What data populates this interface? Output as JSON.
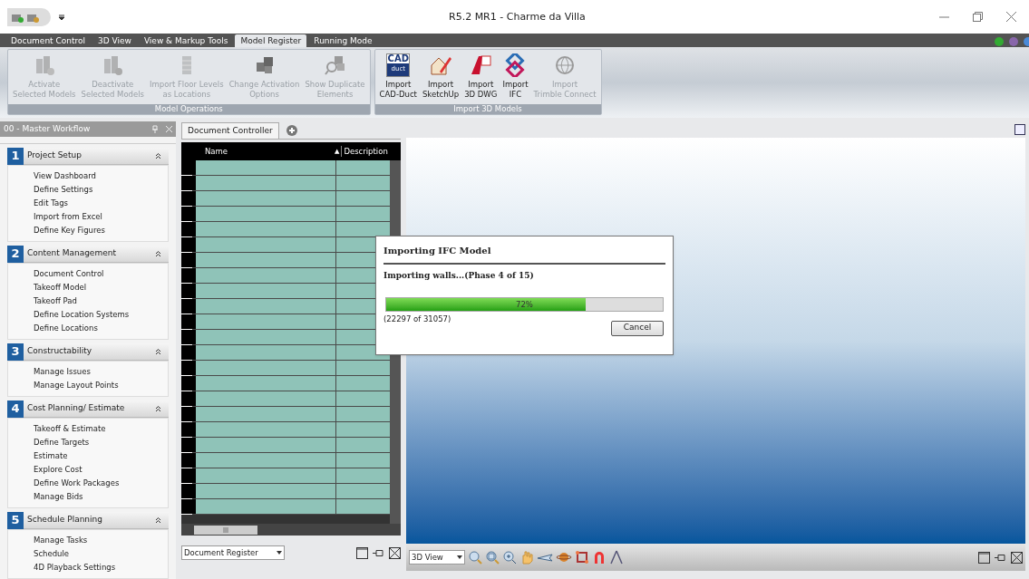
{
  "window": {
    "title": "R5.2 MR1 - Charme da Villa"
  },
  "ribbon_tabs": [
    {
      "label": "Document Control",
      "selected": false
    },
    {
      "label": "3D View",
      "selected": false
    },
    {
      "label": "View & Markup Tools",
      "selected": false
    },
    {
      "label": "Model Register",
      "selected": true
    },
    {
      "label": "Running Mode",
      "selected": false
    }
  ],
  "ribbon_groups": [
    {
      "label": "Model Operations",
      "buttons": [
        {
          "kind": "activate",
          "label": [
            "Activate",
            "Selected Models"
          ],
          "disabled": true
        },
        {
          "kind": "deactivate",
          "label": [
            "Deactivate",
            "Selected Models"
          ],
          "disabled": true
        },
        {
          "kind": "floors",
          "label": [
            "Import Floor Levels",
            "as Locations"
          ],
          "disabled": true
        },
        {
          "kind": "cubes",
          "label": [
            "Change Activation",
            "Options"
          ],
          "disabled": true
        },
        {
          "kind": "duplicate",
          "label": [
            "Show Duplicate",
            "Elements"
          ],
          "disabled": true
        }
      ]
    },
    {
      "label": "Import 3D Models",
      "buttons": [
        {
          "kind": "cad",
          "label": [
            "Import",
            "CAD-Duct"
          ],
          "disabled": false,
          "icon_text": [
            "CAD",
            "duct"
          ]
        },
        {
          "kind": "sketchup",
          "label": [
            "Import",
            "SketchUp"
          ],
          "disabled": false
        },
        {
          "kind": "dwg",
          "label": [
            "Import",
            "3D DWG"
          ],
          "disabled": false
        },
        {
          "kind": "ifc",
          "label": [
            "Import",
            "IFC"
          ],
          "disabled": false
        },
        {
          "kind": "trimble",
          "label": [
            "Import",
            "Trimble Connect"
          ],
          "disabled": true
        }
      ]
    }
  ],
  "workflow": {
    "title": "00 - Master Workflow",
    "sections": [
      {
        "number": "1",
        "title": "Project Setup",
        "expanded": true,
        "items": [
          "View Dashboard",
          "Define Settings",
          "Edit Tags",
          "Import from Excel",
          "Define Key Figures"
        ]
      },
      {
        "number": "2",
        "title": "Content Management",
        "expanded": true,
        "items": [
          "Document Control",
          "Takeoff Model",
          "Takeoff Pad",
          "Define Location Systems",
          "Define Locations"
        ]
      },
      {
        "number": "3",
        "title": "Constructability",
        "expanded": true,
        "items": [
          "Manage Issues",
          "Manage Layout Points"
        ]
      },
      {
        "number": "4",
        "title": "Cost Planning/ Estimate",
        "expanded": true,
        "items": [
          "Takeoff & Estimate",
          "Define Targets",
          "Estimate",
          "Explore Cost",
          "Define Work Packages",
          "Manage Bids"
        ]
      },
      {
        "number": "5",
        "title": "Schedule Planning",
        "expanded": true,
        "items": [
          "Manage Tasks",
          "Schedule",
          "4D Playback Settings"
        ]
      }
    ]
  },
  "document_tabs": [
    {
      "label": "Document Controller",
      "selected": true
    }
  ],
  "grid": {
    "columns": [
      "Name",
      "Description"
    ],
    "sort_mark": "▲"
  },
  "register_dropdown": {
    "value": "Document Register"
  },
  "view_dropdown": {
    "value": "3D View"
  },
  "dialog": {
    "title": "Importing IFC Model",
    "phase": "Importing walls...(Phase 4 of 15)",
    "progress": {
      "level": 0.72,
      "reading": "72%"
    },
    "count": "(22297 of 31057)",
    "button": "Cancel"
  }
}
